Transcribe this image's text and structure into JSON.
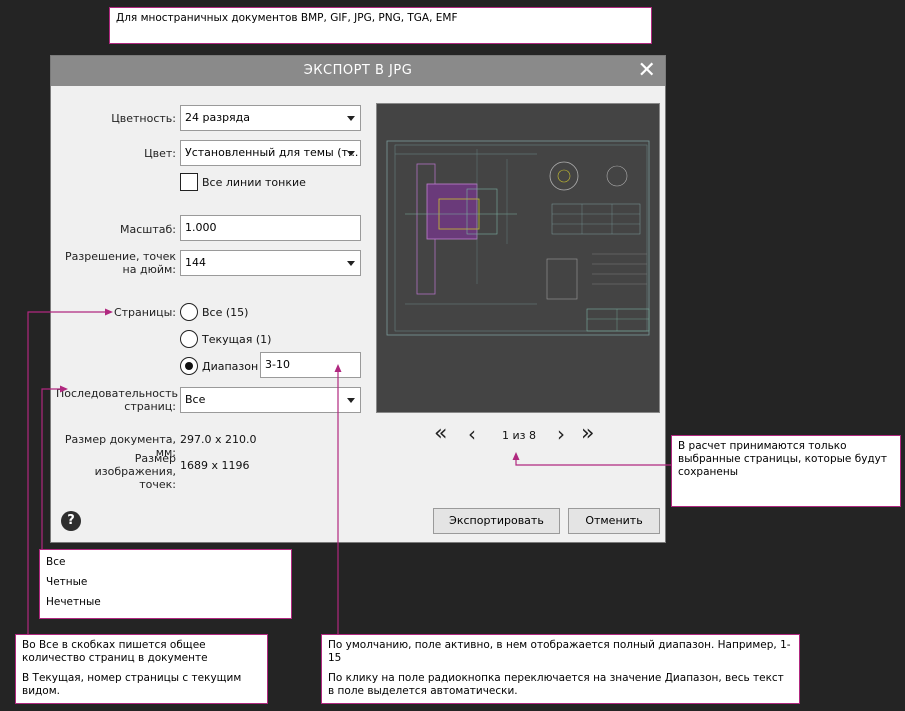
{
  "notes": {
    "top": "Для мностраничных документов BMP, GIF, JPG, PNG, TGA, EMF",
    "right": "В расчет принимаются только выбранные страницы, которые будут сохранены",
    "sequence_options": [
      "Все",
      "Четные",
      "Нечетные"
    ],
    "pages_left": [
      "Во Все в скобках пишется общее количество страниц в документе",
      "В Текущая, номер страницы с текущим видом."
    ],
    "range_bottom": [
      "По умолчанию, поле активно, в нем отображается полный диапазон. Например, 1-15",
      "По клику на поле радиокнопка переключается на значение Диапазон, весь текст в поле выделется автоматически."
    ]
  },
  "dialog": {
    "title": "ЭКСПОРТ В JPG",
    "close": "✕",
    "color_depth": {
      "label": "Цветность:",
      "value": "24 разряда"
    },
    "color": {
      "label": "Цвет:",
      "value": "Установленный для темы (т..."
    },
    "thin_lines": {
      "label": "Все линии тонкие",
      "checked": false
    },
    "scale": {
      "label": "Масштаб:",
      "value": "1.000"
    },
    "resolution": {
      "label": "Разрешение, точек на дюйм:",
      "value": "144"
    },
    "pages": {
      "label": "Страницы:",
      "all": "Все (15)",
      "current": "Текущая (1)",
      "range": "Диапазон",
      "range_value": "3-10",
      "selected": "range"
    },
    "sequence": {
      "label": "Последовательность страниц:",
      "value": "Все"
    },
    "doc_size": {
      "label": "Размер документа, мм:",
      "value": "297.0 x 210.0"
    },
    "image_size": {
      "label": "Размер изображения, точек:",
      "value": "1689 x 1196"
    },
    "pager": {
      "text": "1 из 8"
    },
    "help": "?",
    "export_button": "Экспортировать",
    "cancel_button": "Отменить"
  },
  "colors": {
    "annotation": "#b0287f",
    "background": "#242424",
    "titlebar": "#8a8a8a"
  }
}
